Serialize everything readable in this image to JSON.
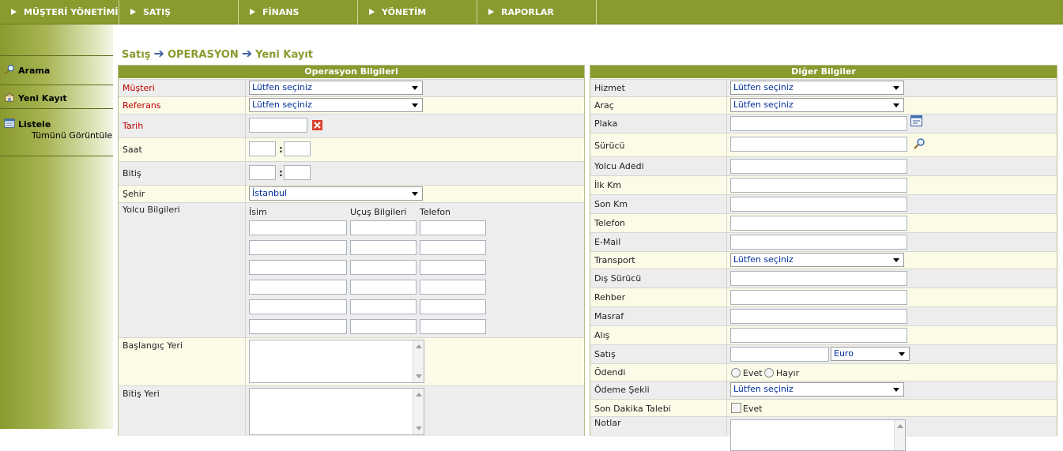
{
  "nav": {
    "items": [
      {
        "label": "MÜŞTERİ YÖNETİMİ"
      },
      {
        "label": "SATIŞ"
      },
      {
        "label": "FİNANS"
      },
      {
        "label": "YÖNETİM"
      },
      {
        "label": "RAPORLAR"
      }
    ]
  },
  "sidebar": {
    "search_label": "Arama",
    "new_label": "Yeni Kayıt",
    "list_label": "Listele",
    "list_sub_label": "Tümünü Görüntüle"
  },
  "breadcrumb": {
    "part1": "Satış",
    "part2": "OPERASYON",
    "part3": "Yeni Kayıt",
    "arrow": "➔"
  },
  "left_panel": {
    "title": "Operasyon Bilgileri",
    "musteri_label": "Müşteri",
    "musteri_value": "Lütfen seçiniz",
    "referans_label": "Referans",
    "referans_value": "Lütfen seçiniz",
    "tarih_label": "Tarih",
    "saat_label": "Saat",
    "bitis_label": "Bitiş",
    "colon": ":",
    "sehir_label": "Şehir",
    "sehir_value": "İstanbul",
    "yolcu_label": "Yolcu Bilgileri",
    "col_isim": "İsim",
    "col_ucus": "Uçuş Bilgileri",
    "col_telefon": "Telefon",
    "baslangic_label": "Başlangıç Yeri",
    "bitis_yeri_label": "Bitiş Yeri"
  },
  "right_panel": {
    "title": "Diğer Bilgiler",
    "hizmet_label": "Hizmet",
    "hizmet_value": "Lütfen seçiniz",
    "arac_label": "Araç",
    "arac_value": "Lütfen seçiniz",
    "plaka_label": "Plaka",
    "surucu_label": "Sürücü",
    "yolcu_adedi_label": "Yolcu Adedi",
    "ilk_km_label": "İlk Km",
    "son_km_label": "Son Km",
    "telefon_label": "Telefon",
    "email_label": "E-Mail",
    "transport_label": "Transport",
    "transport_value": "Lütfen seçiniz",
    "dis_surucu_label": "Dış Sürücü",
    "rehber_label": "Rehber",
    "masraf_label": "Masraf",
    "alis_label": "Alış",
    "satis_label": "Satış",
    "currency_value": "Euro",
    "odendi_label": "Ödendi",
    "evet_label": "Evet",
    "hayir_label": "Hayır",
    "odeme_label": "Ödeme Şekli",
    "odeme_value": "Lütfen seçiniz",
    "son_dakika_label": "Son Dakika Talebi",
    "son_dakika_evet": "Evet",
    "notlar_label": "Notlar"
  },
  "colors": {
    "brand_green": "#8a9a2f",
    "required_red": "#c00000",
    "select_text_blue": "#00309a",
    "breadcrumb_arrow": "#3b5fa0"
  }
}
